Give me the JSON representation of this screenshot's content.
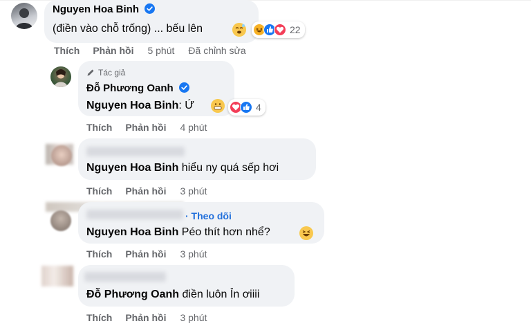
{
  "comments": [
    {
      "author": "Nguyen Hoa Binh",
      "text": "(điền vào chỗ trống) ... bếu lên",
      "reaction_count": "22",
      "actions": {
        "like": "Thích",
        "reply": "Phản hồi",
        "time": "5 phút",
        "edited": "Đã chỉnh sửa"
      }
    },
    {
      "badge": "Tác giả",
      "author": "Đỗ Phương Oanh",
      "mention": "Nguyen Hoa Binh",
      "text": ": Ứ",
      "reaction_count": "4",
      "actions": {
        "like": "Thích",
        "reply": "Phản hồi",
        "time": "4 phút"
      }
    },
    {
      "mention": "Nguyen Hoa Binh",
      "text": " hiểu ny quá sếp hơi",
      "actions": {
        "like": "Thích",
        "reply": "Phản hồi",
        "time": "3 phút"
      }
    },
    {
      "follow": "· Theo dõi",
      "mention": "Nguyen Hoa Binh",
      "text": " Péo thít hơn nhể?",
      "actions": {
        "like": "Thích",
        "reply": "Phản hồi",
        "time": "3 phút"
      }
    },
    {
      "mention": "Đỗ Phương Oanh",
      "text": " điền luôn Ỉn ơiiii",
      "actions": {
        "like": "Thích",
        "reply": "Phản hồi",
        "time": "3 phút"
      }
    }
  ],
  "icons": {
    "verified": "verified-badge-icon",
    "pencil": "pencil-icon",
    "haha": "haha-reaction-icon",
    "like": "like-reaction-icon",
    "love": "love-reaction-icon"
  },
  "colors": {
    "bubble": "#f0f2f5",
    "link_blue": "#216fdb",
    "meta_gray": "#65676b",
    "verified_blue": "#1877f2"
  }
}
